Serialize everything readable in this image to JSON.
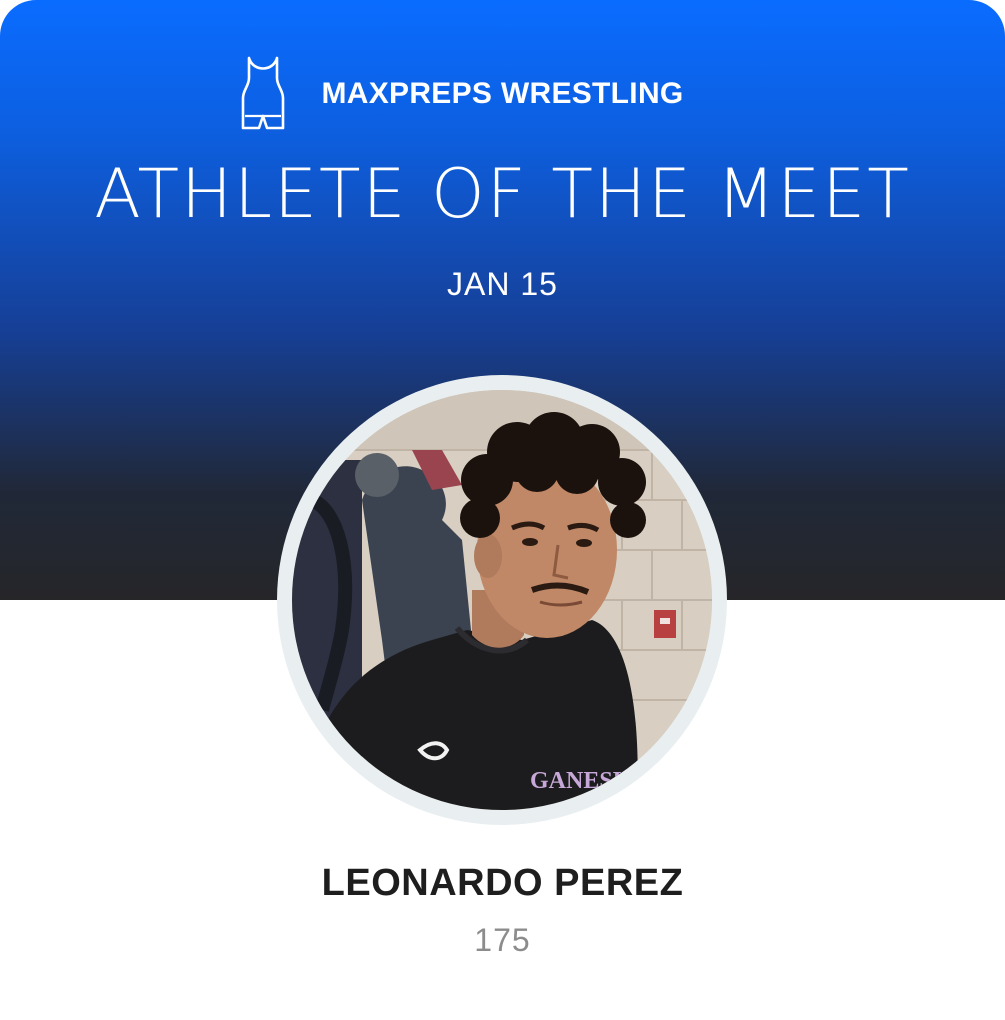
{
  "brand": {
    "label": "MAXPREPS WRESTLING",
    "icon": "wrestling-singlet-icon"
  },
  "title": "ATHLETE OF THE MEET",
  "date": "JAN 15",
  "athlete": {
    "name": "LEONARDO PEREZ",
    "weight": "175",
    "photo_alt": "Athlete photo",
    "shirt_text": "GANESHA"
  },
  "colors": {
    "gradient_top": "#0a6cff",
    "gradient_bottom": "#262629",
    "ring": "#e9eff1",
    "name_text": "#1e1e1e",
    "weight_text": "#8c8c8c"
  }
}
